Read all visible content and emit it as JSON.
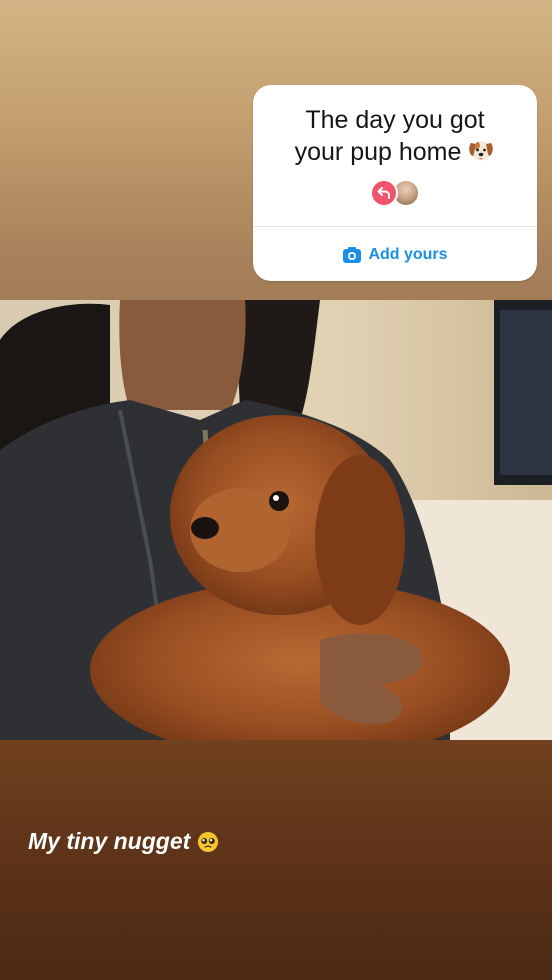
{
  "sticker": {
    "prompt_line1": "The day you got",
    "prompt_line2": "your pup home",
    "prompt_emoji": "dog-face-emoji",
    "add_yours_label": "Add yours"
  },
  "photo": {
    "subject": "photo-dog"
  },
  "caption": {
    "text": "My tiny nugget",
    "emoji": "pleading-face-emoji"
  },
  "colors": {
    "accent_blue": "#1b8fe8",
    "reply_pink": "#f0566b",
    "top_gradient": "#c9a87a",
    "bottom_gradient": "#5b3218"
  }
}
